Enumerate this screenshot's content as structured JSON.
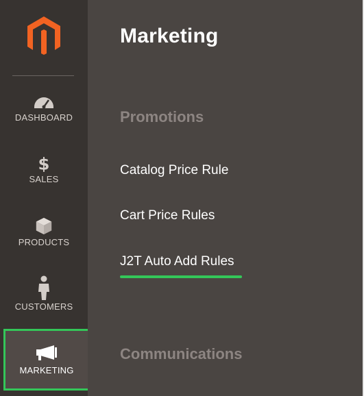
{
  "sidebar": {
    "logo_icon": "magento-logo",
    "items": [
      {
        "label": "DASHBOARD",
        "icon": "speedometer-icon"
      },
      {
        "label": "SALES",
        "icon": "dollar-icon"
      },
      {
        "label": "PRODUCTS",
        "icon": "box-icon"
      },
      {
        "label": "CUSTOMERS",
        "icon": "person-icon"
      },
      {
        "label": "MARKETING",
        "icon": "megaphone-icon",
        "active": true
      }
    ]
  },
  "panel": {
    "title": "Marketing",
    "sections": [
      {
        "title": "Promotions",
        "links": [
          "Catalog Price Rule",
          "Cart Price Rules",
          "J2T Auto Add Rules"
        ]
      },
      {
        "title": "Communications"
      }
    ]
  },
  "colors": {
    "sidebar_bg": "#373330",
    "panel_bg": "#4a4542",
    "logo_orange": "#f26322",
    "highlight_green": "#34c759",
    "section_title": "#8d8582"
  }
}
